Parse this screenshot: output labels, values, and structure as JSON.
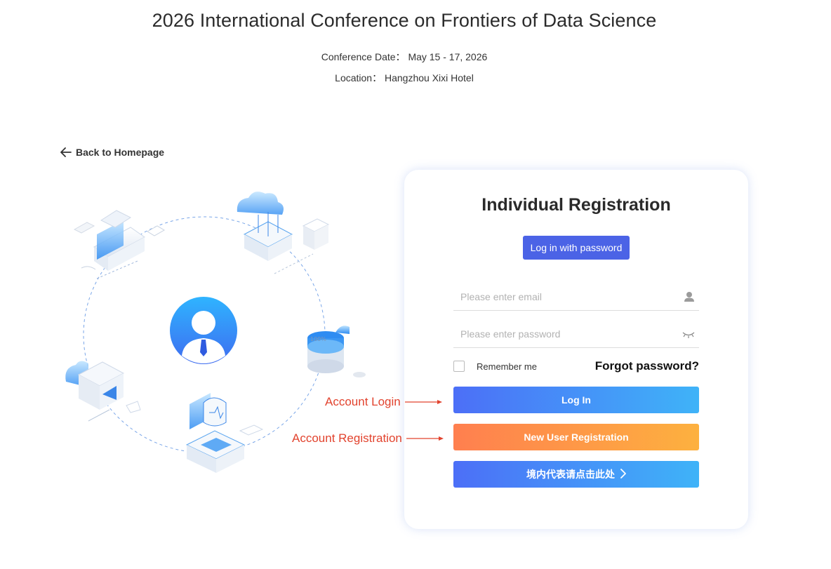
{
  "header": {
    "title": "2026 International Conference on Frontiers of Data Science",
    "date_label": "Conference Date：",
    "date_value": "May 15 - 17, 2026",
    "location_label": "Location：",
    "location_value": "Hangzhou Xixi Hotel"
  },
  "nav": {
    "back_label": "Back to Homepage"
  },
  "card": {
    "title": "Individual Registration",
    "tab_label": "Log in with password",
    "email_placeholder": "Please enter email",
    "password_placeholder": "Please enter password",
    "remember_label": "Remember me",
    "forgot_label": "Forgot password?",
    "login_button": "Log In",
    "register_button": "New User Registration",
    "domestic_button": "境内代表请点击此处"
  },
  "annotations": {
    "login": "Account Login",
    "registration": "Account Registration"
  },
  "colors": {
    "accent": "#4b63e6",
    "login_gradient": [
      "#4c6ff7",
      "#3fb3f8"
    ],
    "register_gradient": [
      "#ff7f4f",
      "#fdb13f"
    ],
    "annotation": "#e2432e"
  },
  "icons": {
    "back": "arrow-left-icon",
    "email": "user-icon",
    "password": "eye-closed-icon",
    "domestic": "chevron-right-icon"
  }
}
